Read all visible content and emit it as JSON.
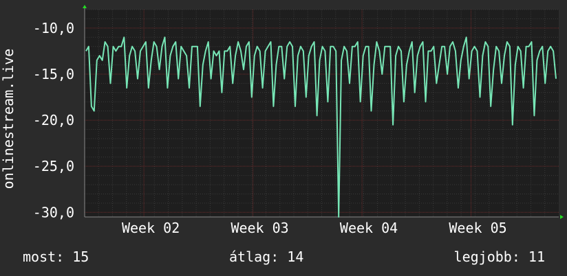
{
  "chart_data": {
    "type": "line",
    "ylabel": "onlinestream.live",
    "ylim": [
      -30.5,
      -8.0
    ],
    "y_ticks": [
      -10,
      -15,
      -20,
      -25,
      -30
    ],
    "y_tick_labels": [
      "-10,0",
      "-15,0",
      "-20,0",
      "-25,0",
      "-30,0"
    ],
    "x_tick_labels": [
      "Week 02",
      "Week 03",
      "Week 04",
      "Week 05"
    ],
    "x_tick_positions": [
      0.125,
      0.355,
      0.585,
      0.815
    ],
    "grid": true,
    "series": [
      {
        "values": [
          -12.5,
          -12.0,
          -18.5,
          -19.0,
          -13.5,
          -13.0,
          -13.5,
          -11.5,
          -12.0,
          -16.0,
          -12.0,
          -12.5,
          -12.0,
          -12.0,
          -11.0,
          -16.5,
          -13.0,
          -12.0,
          -12.5,
          -15.5,
          -12.5,
          -12.0,
          -11.5,
          -16.5,
          -13.5,
          -11.5,
          -12.0,
          -14.5,
          -12.0,
          -11.0,
          -16.5,
          -13.0,
          -12.0,
          -11.5,
          -15.5,
          -12.0,
          -12.5,
          -13.0,
          -16.5,
          -12.0,
          -12.0,
          -12.0,
          -18.5,
          -14.0,
          -12.5,
          -11.5,
          -15.5,
          -12.5,
          -13.0,
          -12.5,
          -17.0,
          -12.5,
          -12.5,
          -12.0,
          -16.0,
          -13.0,
          -11.5,
          -12.5,
          -14.5,
          -12.0,
          -11.5,
          -17.5,
          -13.0,
          -12.0,
          -12.5,
          -16.5,
          -12.5,
          -12.0,
          -11.5,
          -18.5,
          -14.0,
          -12.0,
          -12.0,
          -15.5,
          -12.0,
          -11.5,
          -12.0,
          -18.5,
          -13.0,
          -12.0,
          -12.5,
          -17.5,
          -13.0,
          -12.0,
          -11.5,
          -19.5,
          -13.5,
          -12.0,
          -12.5,
          -18.0,
          -12.0,
          -12.0,
          -12.5,
          -30.5,
          -13.5,
          -12.0,
          -12.5,
          -16.0,
          -12.0,
          -12.0,
          -11.5,
          -18.0,
          -13.0,
          -12.0,
          -12.0,
          -19.0,
          -14.0,
          -11.5,
          -12.5,
          -15.0,
          -12.0,
          -12.0,
          -12.0,
          -20.5,
          -13.0,
          -12.0,
          -12.5,
          -18.0,
          -14.0,
          -12.5,
          -11.5,
          -17.0,
          -13.0,
          -12.0,
          -11.5,
          -18.0,
          -12.5,
          -12.5,
          -12.0,
          -16.0,
          -14.0,
          -12.0,
          -12.0,
          -15.0,
          -12.0,
          -11.5,
          -12.5,
          -16.5,
          -13.5,
          -12.0,
          -11.0,
          -15.5,
          -12.5,
          -12.0,
          -12.5,
          -17.5,
          -13.0,
          -11.5,
          -12.0,
          -18.5,
          -14.5,
          -12.0,
          -12.5,
          -16.0,
          -13.0,
          -11.5,
          -12.0,
          -20.5,
          -14.0,
          -12.0,
          -12.5,
          -16.5,
          -12.0,
          -12.0,
          -11.5,
          -19.5,
          -13.5,
          -12.5,
          -12.0,
          -16.0,
          -12.5,
          -12.0,
          -12.5,
          -15.5
        ]
      }
    ]
  },
  "stats": {
    "now": "most: 15",
    "avg": "átlag: 14",
    "best": "legjobb: 11"
  },
  "colors": {
    "background": "#2b2b2b",
    "plot_background": "#1e1e1e",
    "grid_major": "#6e2a2a",
    "grid_minor": "#3a3a3a",
    "line": "#77e6b6",
    "axis_arrow": "#22dd22",
    "text": "#ffffff"
  }
}
